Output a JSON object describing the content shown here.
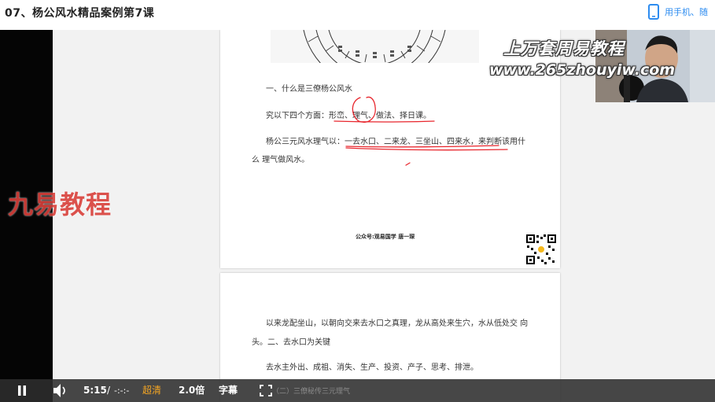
{
  "title": "07、杨公风水精品案例第7课",
  "phone_link": "用手机、随",
  "watermarks": {
    "brand_cn": "上万套周易教程",
    "url": "www.265zhouyiw.com",
    "overlay": "九易教程"
  },
  "document": {
    "page1": {
      "heading": "一、什么是三僚杨公风水",
      "line1": "究以下四个方面：形峦、理气、做法、择日课。",
      "line2": "杨公三元风水理气以：一去水口、二来龙、三坐山、四来水，来判断该用什",
      "line3": "么 理气做风水。",
      "footer": "公众号:观易国学   唐一琛"
    },
    "page2": {
      "line1": "以来龙配坐山，以朝向交来去水口之真理，龙从高处来生穴，水从低处交  向",
      "line2": "头。二、去水口为关键",
      "line3": "去水主外出、成祖、消失、生产、投资、产子、思考、排泄。"
    }
  },
  "player": {
    "current_time": "5:15",
    "separator": "/",
    "total_time": "-:-:-",
    "quality": "超清",
    "speed": "2.0倍",
    "subtitles": "字幕",
    "chapter": "（二）三僚秘传三元理气",
    "quality_color": "#f5a623"
  },
  "colors": {
    "link": "#2d8cf0",
    "underline": "#e8262d",
    "overlay": "#d9403b"
  },
  "icons": [
    "phone-icon",
    "pause-icon",
    "volume-icon",
    "fullscreen-icon",
    "qr-code-icon"
  ]
}
